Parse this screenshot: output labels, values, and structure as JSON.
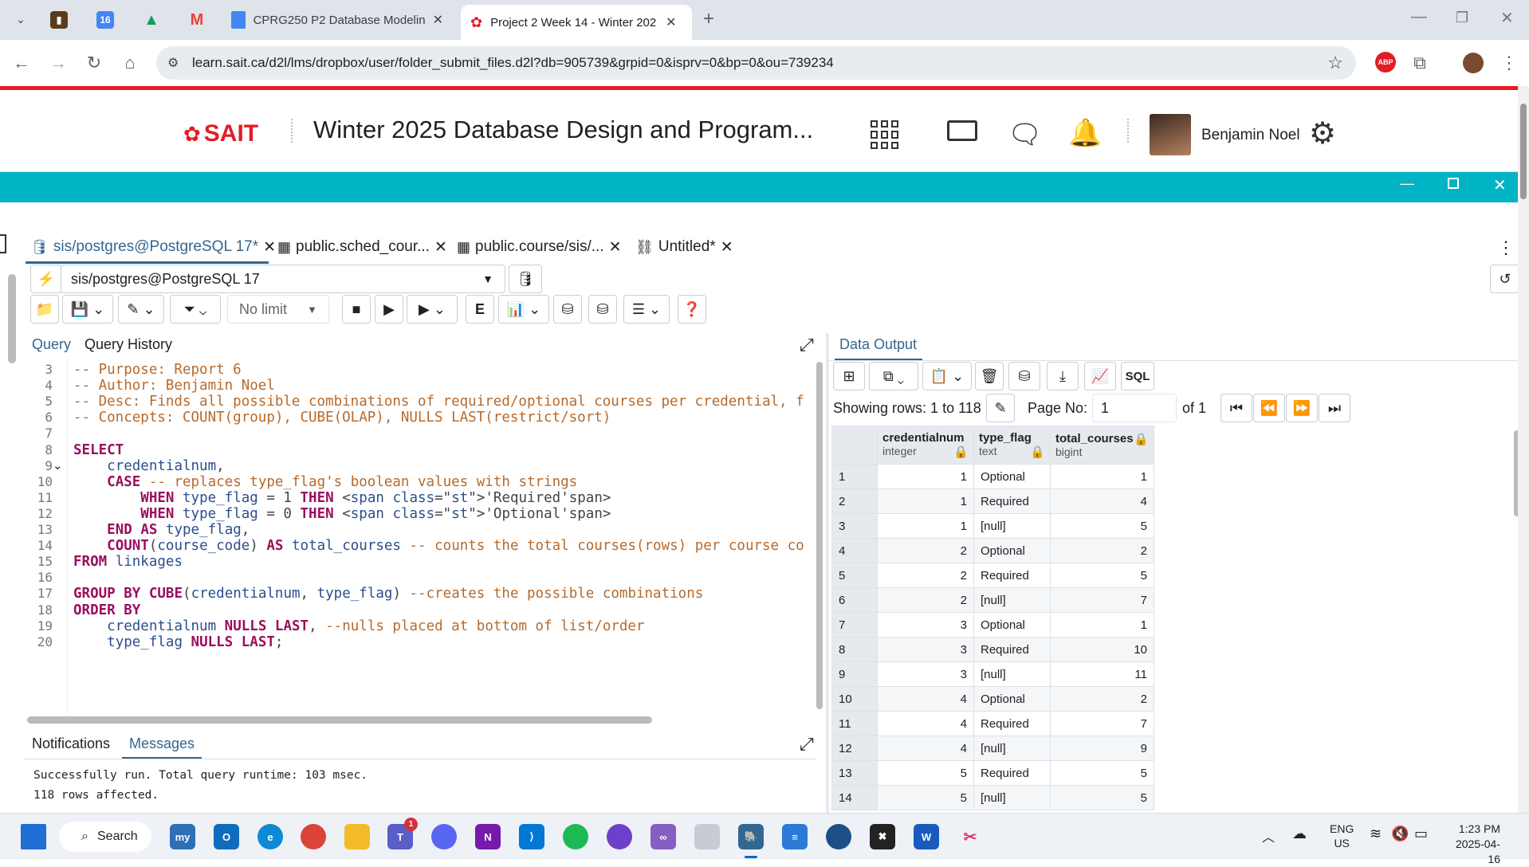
{
  "browser": {
    "tabs": [
      {
        "title": "CPRG250 P2 Database Modelin"
      },
      {
        "title": "Project 2 Week 14 - Winter 202"
      }
    ],
    "url": "learn.sait.ca/d2l/lms/dropbox/user/folder_submit_files.d2l?db=905739&grpid=0&isprv=0&bp=0&ou=739234",
    "new_tab": "+",
    "abp_label": "ABP"
  },
  "d2l": {
    "logo": "SAIT",
    "course_title": "Winter 2025 Database Design and Program...",
    "user_name": "Benjamin Noel"
  },
  "pgadmin": {
    "tabs": [
      {
        "label": "sis/postgres@PostgreSQL 17*"
      },
      {
        "label": "public.sched_cour..."
      },
      {
        "label": "public.course/sis/..."
      },
      {
        "label": "Untitled*"
      }
    ],
    "connection": "sis/postgres@PostgreSQL 17",
    "limit": "No limit",
    "sql_btn": "SQL",
    "query_tabs": [
      "Query",
      "Query History"
    ],
    "editor_lines": [
      {
        "n": "3",
        "code": "-- Purpose: Report 6"
      },
      {
        "n": "4",
        "code": "-- Author: Benjamin Noel"
      },
      {
        "n": "5",
        "code": "-- Desc: Finds all possible combinations of required/optional courses per credential, f"
      },
      {
        "n": "6",
        "code": "-- Concepts: COUNT(group), CUBE(OLAP), NULLS LAST(restrict/sort)"
      },
      {
        "n": "7",
        "code": ""
      },
      {
        "n": "8",
        "code": "SELECT"
      },
      {
        "n": "9",
        "code": "    credentialnum,"
      },
      {
        "n": "10",
        "code": "    CASE -- replaces type_flag's boolean values with strings"
      },
      {
        "n": "11",
        "code": "        WHEN type_flag = 1 THEN 'Required'"
      },
      {
        "n": "12",
        "code": "        WHEN type_flag = 0 THEN 'Optional'"
      },
      {
        "n": "13",
        "code": "    END AS type_flag,"
      },
      {
        "n": "14",
        "code": "    COUNT(course_code) AS total_courses -- counts the total courses(rows) per course co"
      },
      {
        "n": "15",
        "code": "FROM linkages"
      },
      {
        "n": "16",
        "code": ""
      },
      {
        "n": "17",
        "code": "GROUP BY CUBE(credentialnum, type_flag) --creates the possible combinations"
      },
      {
        "n": "18",
        "code": "ORDER BY"
      },
      {
        "n": "19",
        "code": "    credentialnum NULLS LAST, --nulls placed at bottom of list/order"
      },
      {
        "n": "20",
        "code": "    type_flag NULLS LAST;"
      }
    ],
    "bottom_tabs": [
      "Notifications",
      "Messages"
    ],
    "messages": [
      "Successfully run. Total query runtime: 103 msec.",
      "118 rows affected."
    ],
    "output": {
      "tab": "Data Output",
      "showing": "Showing rows: 1 to 118",
      "page_label": "Page No:",
      "page_value": "1",
      "of_label": "of 1",
      "columns": [
        {
          "name": "credentialnum",
          "type": "integer"
        },
        {
          "name": "type_flag",
          "type": "text"
        },
        {
          "name": "total_courses",
          "type": "bigint"
        }
      ],
      "rows": [
        [
          "1",
          "1",
          "Optional",
          "1"
        ],
        [
          "2",
          "1",
          "Required",
          "4"
        ],
        [
          "3",
          "1",
          "[null]",
          "5"
        ],
        [
          "4",
          "2",
          "Optional",
          "2"
        ],
        [
          "5",
          "2",
          "Required",
          "5"
        ],
        [
          "6",
          "2",
          "[null]",
          "7"
        ],
        [
          "7",
          "3",
          "Optional",
          "1"
        ],
        [
          "8",
          "3",
          "Required",
          "10"
        ],
        [
          "9",
          "3",
          "[null]",
          "11"
        ],
        [
          "10",
          "4",
          "Optional",
          "2"
        ],
        [
          "11",
          "4",
          "Required",
          "7"
        ],
        [
          "12",
          "4",
          "[null]",
          "9"
        ],
        [
          "13",
          "5",
          "Required",
          "5"
        ],
        [
          "14",
          "5",
          "[null]",
          "5"
        ]
      ]
    }
  },
  "taskbar": {
    "search": "Search",
    "lang": "ENG",
    "region": "US",
    "time": "1:23 PM",
    "date": "2025-04-16",
    "teams_badge": "1"
  },
  "colors": {
    "accent": "#00b4c5",
    "sait_red": "#e31c25",
    "pg_blue": "#326690"
  }
}
